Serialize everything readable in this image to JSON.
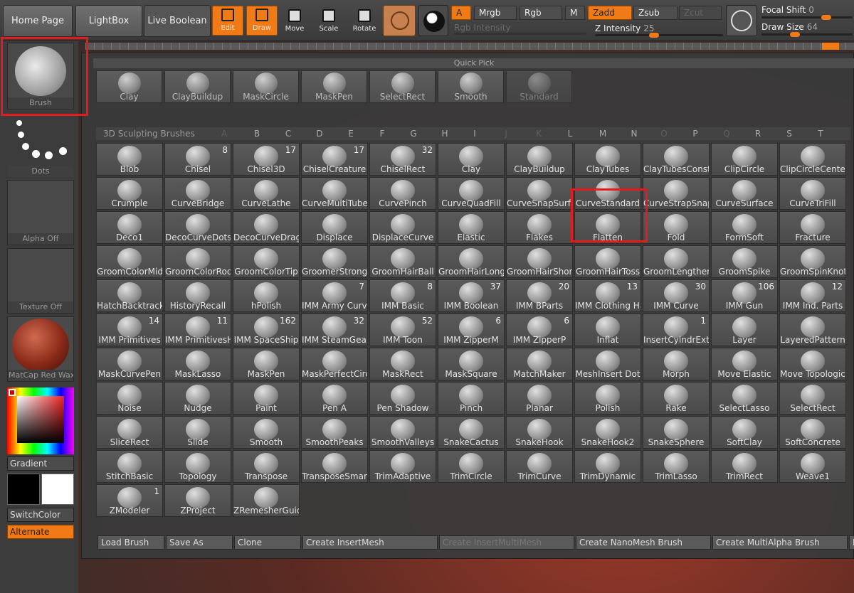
{
  "topbar": {
    "home_page": "Home Page",
    "lightbox": "LightBox",
    "live_boolean": "Live Boolean",
    "tools": [
      {
        "label": "Edit",
        "active": true
      },
      {
        "label": "Draw",
        "active": true
      },
      {
        "label": "Move",
        "active": false
      },
      {
        "label": "Scale",
        "active": false
      },
      {
        "label": "Rotate",
        "active": false
      }
    ],
    "a_label": "A",
    "mrgb": "Mrgb",
    "rgb": "Rgb",
    "m": "M",
    "zadd": "Zadd",
    "zsub": "Zsub",
    "zcut": "Zcut",
    "rgb_intensity": "Rgb Intensity",
    "z_intensity_label": "Z Intensity",
    "z_intensity_value": "25",
    "focal_shift_label": "Focal Shift",
    "focal_shift_value": "0",
    "draw_size_label": "Draw Size",
    "draw_size_value": "64"
  },
  "left": {
    "brush": "Brush",
    "dots": "Dots",
    "alpha": "Alpha Off",
    "texture": "Texture Off",
    "material": "MatCap Red Wax",
    "gradient": "Gradient",
    "switch_color": "SwitchColor",
    "alternate": "Alternate"
  },
  "quick_pick": {
    "title": "Quick Pick",
    "items": [
      "Clay",
      "ClayBuildup",
      "MaskCircle",
      "MaskPen",
      "SelectRect",
      "Smooth",
      "Standard"
    ]
  },
  "library": {
    "title": "3D Sculpting Brushes",
    "letters": [
      "A",
      "B",
      "C",
      "D",
      "E",
      "F",
      "G",
      "H",
      "I",
      "J",
      "K",
      "L",
      "M",
      "N",
      "O",
      "P",
      "Q",
      "R",
      "S",
      "T"
    ],
    "rows": [
      [
        [
          "Blob",
          ""
        ],
        [
          "Chisel",
          "8"
        ],
        [
          "Chisel3D",
          "17"
        ],
        [
          "ChiselCreature",
          "17"
        ],
        [
          "ChiselRect",
          "32"
        ],
        [
          "Clay",
          ""
        ],
        [
          "ClayBuildup",
          ""
        ],
        [
          "ClayTubes",
          ""
        ],
        [
          "ClayTubesConsta",
          ""
        ],
        [
          "ClipCircle",
          ""
        ],
        [
          "ClipCircleCenter",
          ""
        ]
      ],
      [
        [
          "Crumple",
          ""
        ],
        [
          "CurveBridge",
          ""
        ],
        [
          "CurveLathe",
          ""
        ],
        [
          "CurveMultiTube",
          ""
        ],
        [
          "CurvePinch",
          ""
        ],
        [
          "CurveQuadFill",
          ""
        ],
        [
          "CurveSnapSurfa",
          ""
        ],
        [
          "CurveStandard",
          ""
        ],
        [
          "CurveStrapSnap",
          ""
        ],
        [
          "CurveSurface",
          ""
        ],
        [
          "CurveTriFill",
          ""
        ]
      ],
      [
        [
          "Deco1",
          ""
        ],
        [
          "DecoCurveDots",
          ""
        ],
        [
          "DecoCurveDragI",
          ""
        ],
        [
          "Displace",
          ""
        ],
        [
          "DisplaceCurve",
          ""
        ],
        [
          "Elastic",
          ""
        ],
        [
          "Flakes",
          ""
        ],
        [
          "Flatten",
          ""
        ],
        [
          "Fold",
          ""
        ],
        [
          "FormSoft",
          ""
        ],
        [
          "Fracture",
          ""
        ]
      ],
      [
        [
          "GroomColorMid",
          ""
        ],
        [
          "GroomColorRoot",
          ""
        ],
        [
          "GroomColorTip",
          ""
        ],
        [
          "GroomerStrong",
          ""
        ],
        [
          "GroomHairBall",
          ""
        ],
        [
          "GroomHairLong",
          ""
        ],
        [
          "GroomHairShort",
          ""
        ],
        [
          "GroomHairToss",
          ""
        ],
        [
          "GroomLengthen",
          ""
        ],
        [
          "GroomSpike",
          ""
        ],
        [
          "GroomSpinKnot",
          ""
        ]
      ],
      [
        [
          "HatchBacktrack",
          ""
        ],
        [
          "HistoryRecall",
          ""
        ],
        [
          "hPolish",
          ""
        ],
        [
          "IMM Army Curve",
          "7"
        ],
        [
          "IMM Basic",
          "8"
        ],
        [
          "IMM Boolean",
          "37"
        ],
        [
          "IMM BParts",
          "20"
        ],
        [
          "IMM Clothing Ha",
          "13"
        ],
        [
          "IMM Curve",
          "30"
        ],
        [
          "IMM Gun",
          "106"
        ],
        [
          "IMM Ind. Parts",
          "12"
        ]
      ],
      [
        [
          "IMM Primitives",
          "14"
        ],
        [
          "IMM PrimitivesH",
          "11"
        ],
        [
          "IMM SpaceShip",
          "162"
        ],
        [
          "IMM SteamGear",
          "32"
        ],
        [
          "IMM Toon",
          "52"
        ],
        [
          "IMM ZipperM",
          "6"
        ],
        [
          "IMM ZipperP",
          "6"
        ],
        [
          "Inflat",
          ""
        ],
        [
          "InsertCylndrExt",
          "1"
        ],
        [
          "Layer",
          ""
        ],
        [
          "LayeredPattern",
          ""
        ]
      ],
      [
        [
          "MaskCurvePen",
          ""
        ],
        [
          "MaskLasso",
          ""
        ],
        [
          "MaskPen",
          ""
        ],
        [
          "MaskPerfectCirc",
          ""
        ],
        [
          "MaskRect",
          ""
        ],
        [
          "MaskSquare",
          ""
        ],
        [
          "MatchMaker",
          ""
        ],
        [
          "MeshInsert Dot",
          ""
        ],
        [
          "Morph",
          ""
        ],
        [
          "Move Elastic",
          ""
        ],
        [
          "Move Topologica",
          ""
        ]
      ],
      [
        [
          "Noise",
          ""
        ],
        [
          "Nudge",
          ""
        ],
        [
          "Paint",
          ""
        ],
        [
          "Pen A",
          ""
        ],
        [
          "Pen Shadow",
          ""
        ],
        [
          "Pinch",
          ""
        ],
        [
          "Planar",
          ""
        ],
        [
          "Polish",
          ""
        ],
        [
          "Rake",
          ""
        ],
        [
          "SelectLasso",
          ""
        ],
        [
          "SelectRect",
          ""
        ]
      ],
      [
        [
          "SliceRect",
          ""
        ],
        [
          "Slide",
          ""
        ],
        [
          "Smooth",
          ""
        ],
        [
          "SmoothPeaks",
          ""
        ],
        [
          "SmoothValleys",
          ""
        ],
        [
          "SnakeCactus",
          ""
        ],
        [
          "SnakeHook",
          ""
        ],
        [
          "SnakeHook2",
          ""
        ],
        [
          "SnakeSphere",
          ""
        ],
        [
          "SoftClay",
          ""
        ],
        [
          "SoftConcrete",
          ""
        ]
      ],
      [
        [
          "StitchBasic",
          ""
        ],
        [
          "Topology",
          ""
        ],
        [
          "Transpose",
          ""
        ],
        [
          "TransposeSmart",
          ""
        ],
        [
          "TrimAdaptive",
          ""
        ],
        [
          "TrimCircle",
          ""
        ],
        [
          "TrimCurve",
          ""
        ],
        [
          "TrimDynamic",
          ""
        ],
        [
          "TrimLasso",
          ""
        ],
        [
          "TrimRect",
          ""
        ],
        [
          "Weave1",
          ""
        ]
      ],
      [
        [
          "ZModeler",
          "1"
        ],
        [
          "ZProject",
          ""
        ],
        [
          "ZRemesherGuide",
          ""
        ]
      ]
    ]
  },
  "bottom_bar": {
    "buttons": [
      "Load Brush",
      "Save As",
      "Clone",
      "Create InsertMesh",
      "Create InsertMultiMesh",
      "Create NanoMesh Brush",
      "Create MultiAlpha Brush",
      "F"
    ]
  },
  "colors": {
    "accent": "#f07a16",
    "highlight": "#e51a1a"
  }
}
